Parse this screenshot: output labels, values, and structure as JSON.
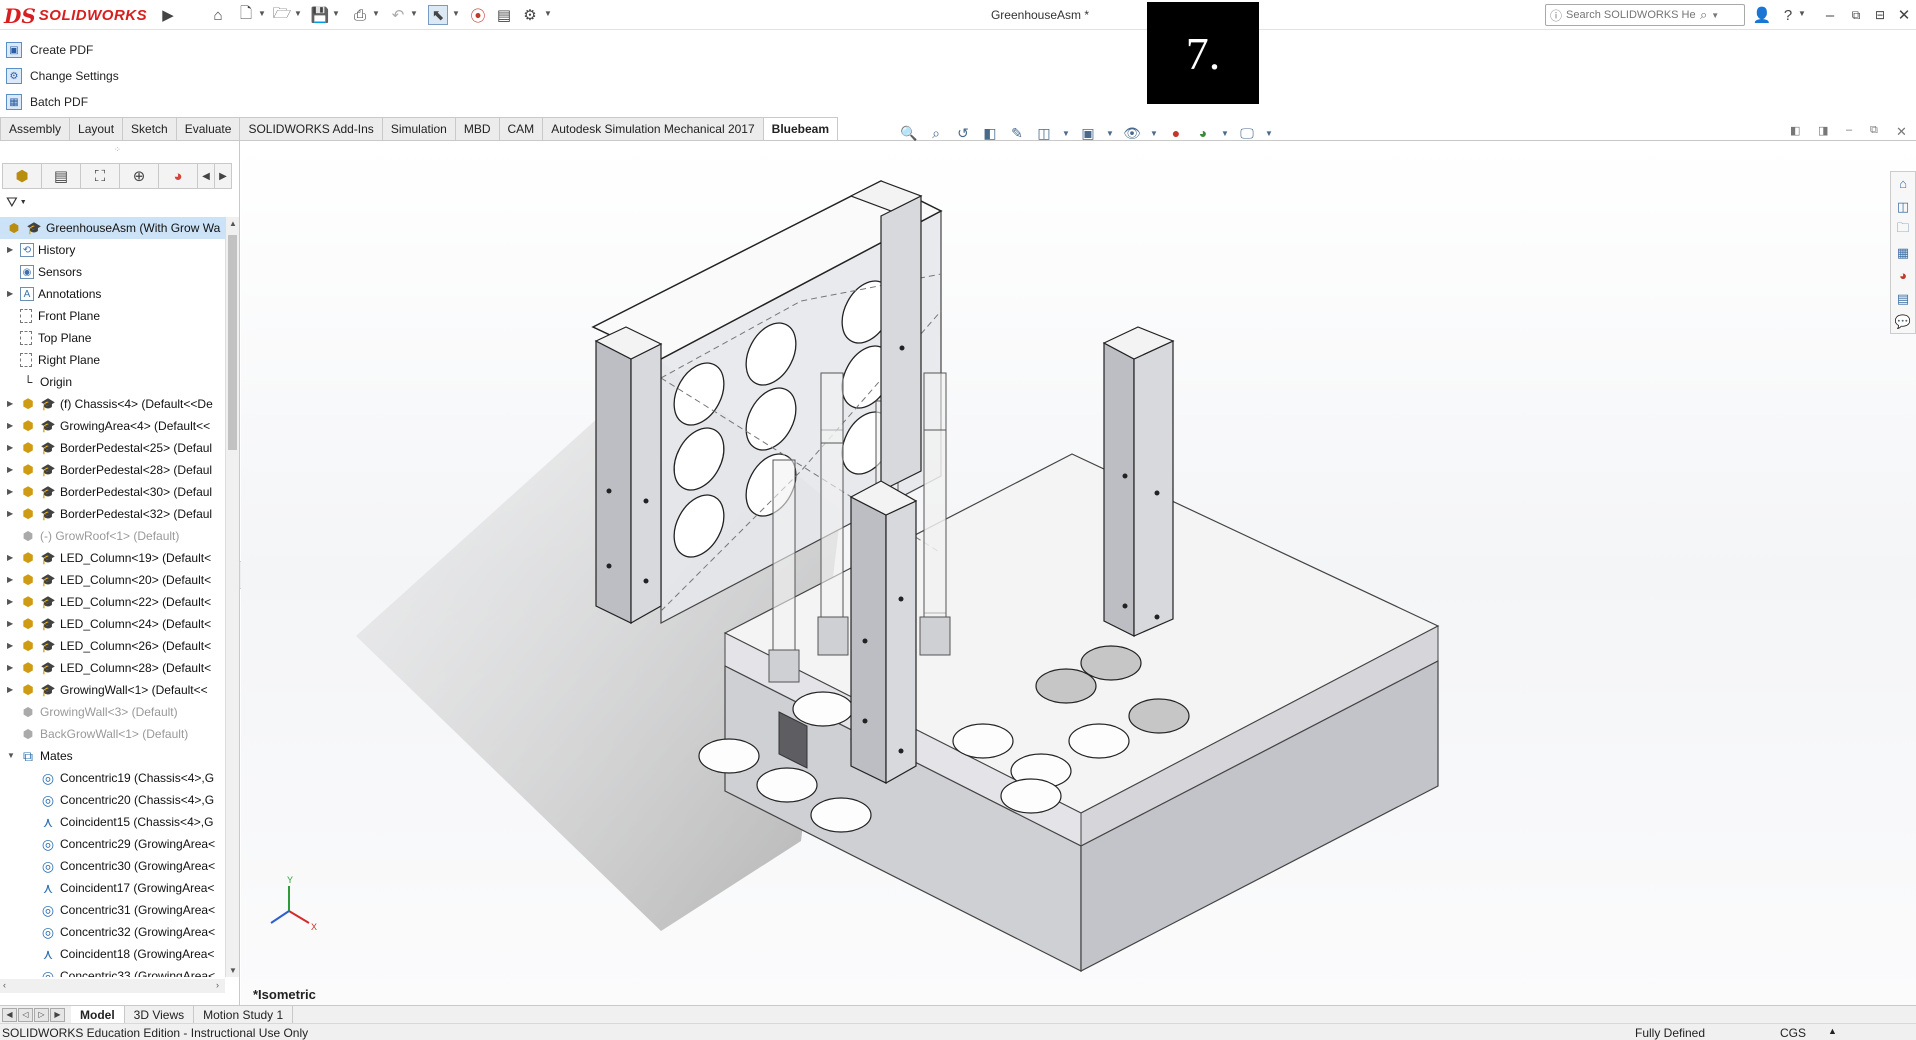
{
  "app": {
    "brand_prefix": "DS",
    "brand": "SOLIDWORKS"
  },
  "title": "GreenhouseAsm *",
  "step_label": "7.",
  "search": {
    "placeholder": "Search SOLIDWORKS Help"
  },
  "command_items": [
    {
      "label": "Create PDF",
      "icon": "create-pdf-icon"
    },
    {
      "label": "Change Settings",
      "icon": "settings-icon"
    },
    {
      "label": "Batch PDF",
      "icon": "batch-pdf-icon"
    }
  ],
  "tabs": [
    "Assembly",
    "Layout",
    "Sketch",
    "Evaluate",
    "SOLIDWORKS Add-Ins",
    "Simulation",
    "MBD",
    "CAM",
    "Autodesk Simulation Mechanical 2017",
    "Bluebeam"
  ],
  "active_tab": "Bluebeam",
  "tree": {
    "root": "GreenhouseAsm  (With Grow Wa",
    "items": [
      {
        "label": "History",
        "icon": "history"
      },
      {
        "label": "Sensors",
        "icon": "sensors"
      },
      {
        "label": "Annotations",
        "icon": "annotations"
      },
      {
        "label": "Front Plane",
        "icon": "plane"
      },
      {
        "label": "Top Plane",
        "icon": "plane"
      },
      {
        "label": "Right Plane",
        "icon": "plane"
      },
      {
        "label": "Origin",
        "icon": "origin"
      },
      {
        "label": "(f) Chassis<4> (Default<<De",
        "icon": "part"
      },
      {
        "label": "GrowingArea<4> (Default<<",
        "icon": "part"
      },
      {
        "label": "BorderPedestal<25> (Defaul",
        "icon": "part"
      },
      {
        "label": "BorderPedestal<28> (Defaul",
        "icon": "part"
      },
      {
        "label": "BorderPedestal<30> (Defaul",
        "icon": "part"
      },
      {
        "label": "BorderPedestal<32> (Defaul",
        "icon": "part"
      },
      {
        "label": "(-) GrowRoof<1> (Default)",
        "icon": "part-suppressed"
      },
      {
        "label": "LED_Column<19> (Default<",
        "icon": "part"
      },
      {
        "label": "LED_Column<20> (Default<",
        "icon": "part"
      },
      {
        "label": "LED_Column<22> (Default<",
        "icon": "part"
      },
      {
        "label": "LED_Column<24> (Default<",
        "icon": "part"
      },
      {
        "label": "LED_Column<26> (Default<",
        "icon": "part"
      },
      {
        "label": "LED_Column<28> (Default<",
        "icon": "part"
      },
      {
        "label": "GrowingWall<1> (Default<<",
        "icon": "part"
      },
      {
        "label": "GrowingWall<3> (Default)",
        "icon": "part-suppressed"
      },
      {
        "label": "BackGrowWall<1> (Default)",
        "icon": "part-suppressed"
      },
      {
        "label": "Mates",
        "icon": "mates"
      },
      {
        "label": "Concentric19 (Chassis<4>,G",
        "icon": "mate-concentric"
      },
      {
        "label": "Concentric20 (Chassis<4>,G",
        "icon": "mate-concentric"
      },
      {
        "label": "Coincident15 (Chassis<4>,G",
        "icon": "mate-coincident"
      },
      {
        "label": "Concentric29 (GrowingArea<",
        "icon": "mate-concentric"
      },
      {
        "label": "Concentric30 (GrowingArea<",
        "icon": "mate-concentric"
      },
      {
        "label": "Coincident17 (GrowingArea<",
        "icon": "mate-coincident"
      },
      {
        "label": "Concentric31 (GrowingArea<",
        "icon": "mate-concentric"
      },
      {
        "label": "Concentric32 (GrowingArea<",
        "icon": "mate-concentric"
      },
      {
        "label": "Coincident18 (GrowingArea<",
        "icon": "mate-coincident"
      },
      {
        "label": "Concentric33 (GrowingArea<",
        "icon": "mate-concentric"
      }
    ]
  },
  "view": {
    "orientation": "*Isometric"
  },
  "bottom_tabs": [
    "Model",
    "3D Views",
    "Motion Study 1"
  ],
  "active_bottom_tab": "Model",
  "status": {
    "left": "SOLIDWORKS Education Edition - Instructional Use Only",
    "state": "Fully Defined",
    "units": "CGS",
    "units_arrow": "▲"
  },
  "colors": {
    "brand_red": "#d81e1e",
    "selection_blue": "#cce3f7",
    "model_gray": "#d9dadf",
    "mate_blue": "#2d6fb1"
  }
}
